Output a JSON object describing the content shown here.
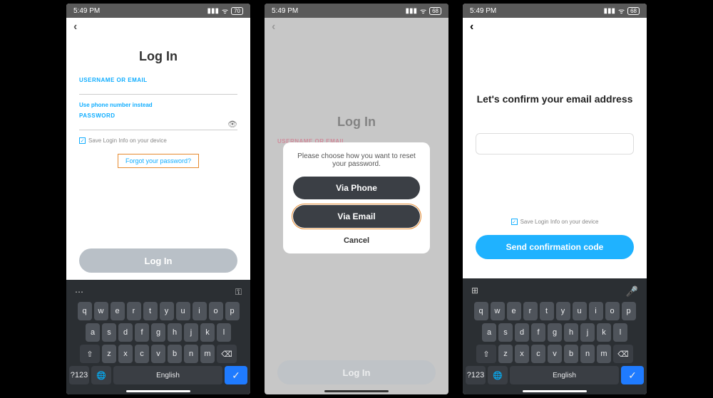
{
  "status": {
    "time": "5:49 PM",
    "battery1": "70",
    "battery2": "68",
    "battery3": "68"
  },
  "screen1": {
    "title": "Log In",
    "username_label": "USERNAME OR EMAIL",
    "phone_link": "Use phone number instead",
    "password_label": "PASSWORD",
    "save_info": "Save Login Info on your device",
    "forgot": "Forgot your password?",
    "login_btn": "Log In"
  },
  "screen2": {
    "title": "Log In",
    "username_label": "USERNAME OR EMAIL",
    "dialog_msg": "Please choose how you want to reset your password.",
    "via_phone": "Via Phone",
    "via_email": "Via Email",
    "cancel": "Cancel",
    "login_btn": "Log In"
  },
  "screen3": {
    "title": "Let's confirm your email address",
    "save_info": "Save Login Info on your device",
    "send_btn": "Send confirmation code"
  },
  "keyboard": {
    "rows": [
      [
        "q",
        "w",
        "e",
        "r",
        "t",
        "y",
        "u",
        "i",
        "o",
        "p"
      ],
      [
        "a",
        "s",
        "d",
        "f",
        "g",
        "h",
        "j",
        "k",
        "l"
      ],
      [
        "z",
        "x",
        "c",
        "v",
        "b",
        "n",
        "m"
      ]
    ],
    "shift": "⇧",
    "backspace": "⌫",
    "num": "?123",
    "globe": "🌐",
    "lang": "English",
    "enter": "✓",
    "key_icon": "⚿",
    "dots": "⋯",
    "grid": "⊞",
    "mic": "🎤"
  }
}
